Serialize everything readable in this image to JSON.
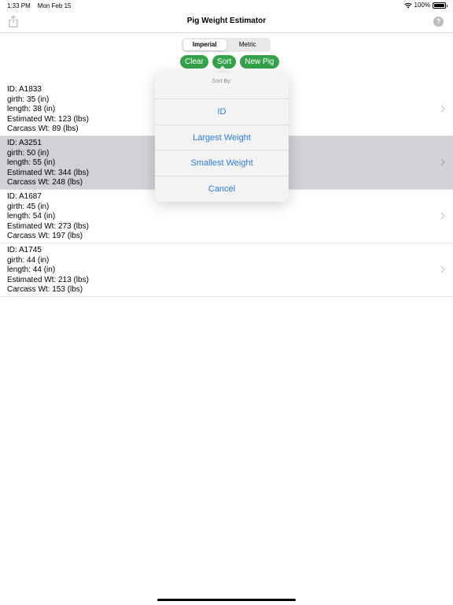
{
  "status_bar": {
    "time": "1:33 PM",
    "date": "Mon Feb 15",
    "battery": "100%"
  },
  "nav": {
    "title": "Pig Weight Estimator",
    "help_label": "?"
  },
  "segmented": {
    "options": [
      "Imperial",
      "Metric"
    ],
    "selected": "Imperial"
  },
  "actions": {
    "clear": "Clear",
    "sort": "Sort",
    "new_pig": "New Pig"
  },
  "pigs": [
    {
      "id": "ID: A1833",
      "girth": "girth: 35 (in)",
      "length": "length: 38 (in)",
      "est": "Estimated Wt: 123 (lbs)",
      "carcass": "Carcass Wt: 89 (lbs)"
    },
    {
      "id": "ID: A3251",
      "girth": "girth: 50 (in)",
      "length": "length: 55 (in)",
      "est": "Estimated Wt: 344 (lbs)",
      "carcass": "Carcass Wt: 248 (lbs)"
    },
    {
      "id": "ID: A1687",
      "girth": "girth: 45 (in)",
      "length": "length: 54 (in)",
      "est": "Estimated Wt: 273 (lbs)",
      "carcass": "Carcass Wt: 197 (lbs)"
    },
    {
      "id": "ID: A1745",
      "girth": "girth: 44 (in)",
      "length": "length: 44 (in)",
      "est": "Estimated Wt: 213 (lbs)",
      "carcass": "Carcass Wt: 153 (lbs)"
    }
  ],
  "sort_menu": {
    "title": "Sort By:",
    "options": [
      "ID",
      "Largest Weight",
      "Smallest Weight"
    ],
    "cancel": "Cancel"
  },
  "colors": {
    "accent_green": "#34a24a",
    "link_blue": "#2b7be5",
    "selected_row": "#d1d1d6"
  },
  "icons": [
    "wifi-icon",
    "battery-icon",
    "share-icon",
    "help-icon",
    "chevron-right-icon"
  ]
}
